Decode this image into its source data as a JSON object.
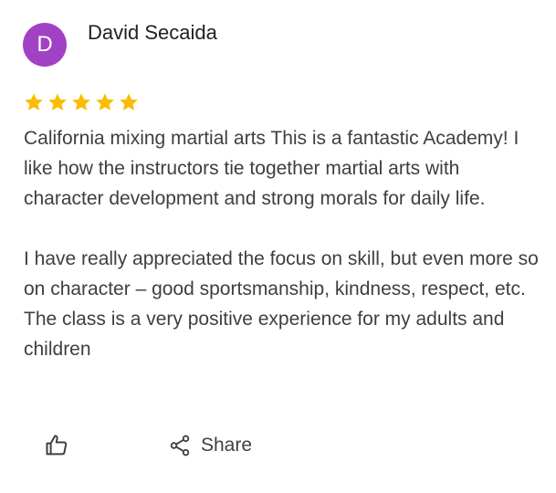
{
  "review": {
    "avatar_initial": "D",
    "avatar_color": "#a142c4",
    "author_name": "David Secaida",
    "rating": 5,
    "rating_max": 5,
    "star_color": "#fbbc04",
    "paragraphs": [
      "California mixing martial arts This is a fantastic Academy! I like how the instructors tie together martial arts with character development and strong morals for daily life.",
      "I have really appreciated the focus on skill, but even more so on character – good sportsmanship, kindness, respect, etc. The class is a very positive experience for my adults and children"
    ]
  },
  "actions": {
    "like_icon": "thumb-up-icon",
    "share_icon": "share-icon",
    "share_label": "Share"
  }
}
